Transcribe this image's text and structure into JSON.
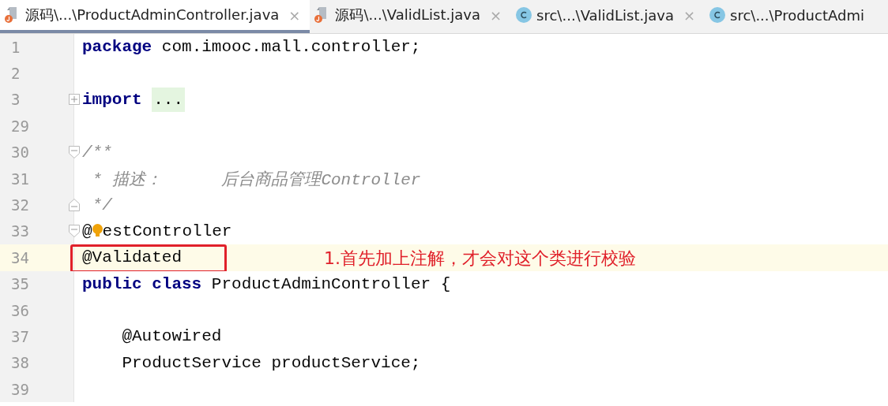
{
  "tabs": [
    {
      "label": "源码\\...\\ProductAdminController.java",
      "kind": "java",
      "selected": true,
      "close": "×"
    },
    {
      "label": "源码\\...\\ValidList.java",
      "kind": "java",
      "selected": false,
      "close": "×"
    },
    {
      "label": "src\\...\\ValidList.java",
      "kind": "class",
      "selected": false,
      "close": "×"
    },
    {
      "label": "src\\...\\ProductAdmi",
      "kind": "class",
      "selected": false
    }
  ],
  "lines": [
    {
      "number": "1",
      "segments": [
        {
          "kind": "keyword",
          "text": "package"
        },
        {
          "kind": "plain",
          "text": " com.imooc.mall.controller;"
        }
      ]
    },
    {
      "number": "2"
    },
    {
      "number": "3",
      "fold": {
        "kind": "collapsed"
      },
      "segments": [
        {
          "kind": "keyword",
          "text": "import "
        },
        {
          "kind": "folded",
          "text": "..."
        }
      ]
    },
    {
      "number": "29"
    },
    {
      "number": "30",
      "fold": {
        "kind": "open"
      },
      "segments": [
        {
          "kind": "comment",
          "text": "/**"
        }
      ]
    },
    {
      "number": "31",
      "segments": [
        {
          "kind": "comment",
          "text": " * 描述：      后台商品管理Controller"
        }
      ]
    },
    {
      "number": "32",
      "fold": {
        "kind": "end"
      },
      "segments": [
        {
          "kind": "comment",
          "text": " */"
        }
      ]
    },
    {
      "number": "33",
      "fold": {
        "kind": "open"
      },
      "segments": [
        {
          "kind": "plain",
          "text": "@"
        },
        {
          "kind": "bulb"
        },
        {
          "kind": "plain",
          "text": "estController"
        }
      ]
    },
    {
      "number": "34",
      "current": true,
      "boxed": true,
      "callout": "1.首先加上注解，才会对这个类进行校验",
      "segments": [
        {
          "kind": "plain",
          "text": "@Validated"
        }
      ]
    },
    {
      "number": "35",
      "segments": [
        {
          "kind": "keyword",
          "text": "public class"
        },
        {
          "kind": "plain",
          "text": " ProductAdminController {"
        }
      ]
    },
    {
      "number": "36"
    },
    {
      "number": "37",
      "segments": [
        {
          "kind": "plain",
          "text": "    @Autowired"
        }
      ]
    },
    {
      "number": "38",
      "segments": [
        {
          "kind": "plain",
          "text": "    ProductService productService;"
        }
      ]
    },
    {
      "number": "39"
    }
  ]
}
